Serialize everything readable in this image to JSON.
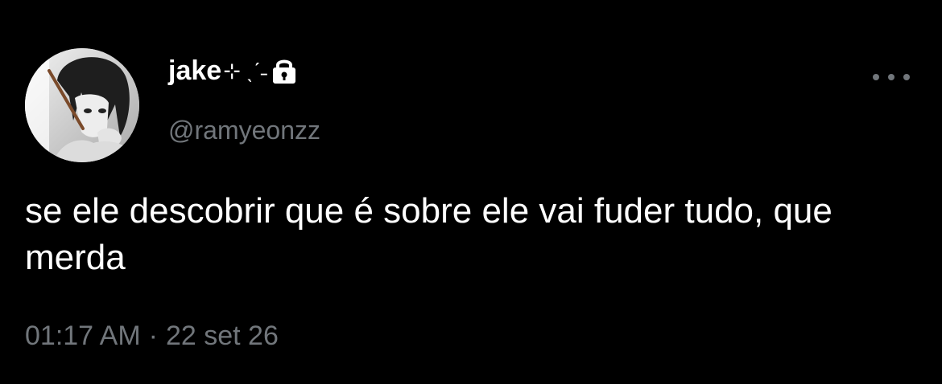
{
  "author": {
    "display_name": "jake",
    "decoration": "⊹ ˎˊ˗",
    "handle": "@ramyeonzz",
    "protected_icon": "lock-icon",
    "avatar": "anime-character-avatar"
  },
  "tweet": {
    "text": "se ele descobrir que é sobre ele vai fuder tudo, que merda",
    "time": "01:17 AM",
    "separator": "·",
    "date": "22 set 26"
  },
  "actions": {
    "more_icon": "more-horizontal-icon"
  },
  "colors": {
    "background": "#000000",
    "primary_text": "#ffffff",
    "secondary_text": "#71767b"
  }
}
